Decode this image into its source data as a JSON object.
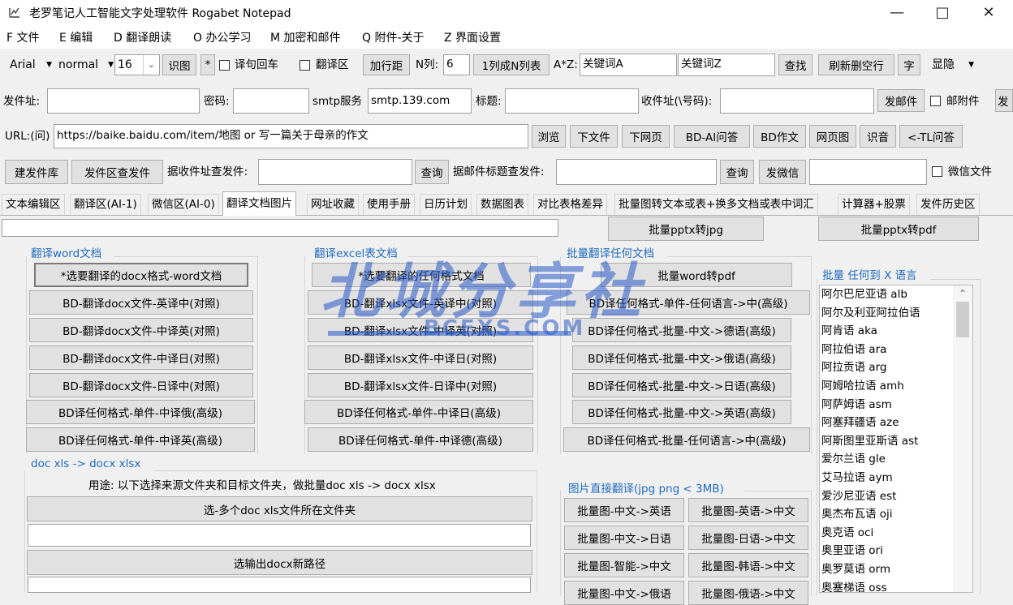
{
  "window": {
    "title": "老罗笔记人工智能文字处理软件 Rogabet Notepad"
  },
  "menu": [
    "F 文件",
    "E 编辑",
    "D 翻译朗读",
    "O 办公学习",
    "M 加密和邮件",
    "Q 附件-关于",
    "Z 界面设置"
  ],
  "toolbar1": {
    "font": "Arial",
    "style": "normal",
    "size": "16",
    "recognize": "识图",
    "star": "*",
    "wrap_label": "译句回车",
    "transarea_label": "翻译区",
    "add_spacing": "加行距",
    "ncol_label": "N列:",
    "ncol_value": "6",
    "one_to_n": "1列成N列表",
    "az_label": "A*Z:",
    "keyword_a": "关键词A",
    "keyword_z": "关键词Z",
    "find": "查找",
    "refresh_blank": "刷新删空行",
    "char": "字",
    "show_hide": "显隐"
  },
  "toolbar2": {
    "sender_label": "发件址:",
    "password_label": "密码:",
    "smtp_label": "smtp服务",
    "smtp_value": "smtp.139.com",
    "subject_label": "标题:",
    "recipient_label": "收件址(\\号码):",
    "send_mail": "发邮件",
    "attach_label": "邮附件",
    "extra": "发"
  },
  "toolbar3": {
    "url_label": "URL:(问)",
    "url_value": "https://baike.baidu.com/item/地图 or 写一篇关于母亲的作文",
    "browse": "浏览",
    "download_file": "下文件",
    "download_page": "下网页",
    "bd_ai": "BD-AI问答",
    "bd_essay": "BD作文",
    "webpage_image": "网页图",
    "recognize_sound": "识音",
    "tl_qa": "<-TL问答"
  },
  "toolbar4": {
    "build_library": "建发件库",
    "query_sent": "发件区查发件",
    "by_recipient_label": "据收件址查发件:",
    "query1": "查询",
    "by_subject_label": "据邮件标题查发件:",
    "query2": "查询",
    "send_wechat": "发微信",
    "wechat_file_label": "微信文件"
  },
  "tabs": [
    "文本编辑区",
    "翻译区(AI-1)",
    "微信区(AI-0)",
    "翻译文档图片",
    "网址收藏",
    "使用手册",
    "日历计划",
    "数据图表",
    "对比表格差异",
    "批量图转文本或表+换多文档或表中词汇",
    "计算器+股票",
    "发件历史区"
  ],
  "active_tab_index": 3,
  "top_buttons": {
    "pptx_jpg": "批量pptx转jpg",
    "pptx_pdf": "批量pptx转pdf"
  },
  "word_group": {
    "title": "翻译word文档",
    "buttons": [
      "*选要翻译的docx格式-word文档",
      "BD-翻译docx文件-英译中(对照)",
      "BD-翻译docx文件-中译英(对照)",
      "BD-翻译docx文件-中译日(对照)",
      "BD-翻译docx文件-日译中(对照)",
      "BD译任何格式-单件-中译俄(高级)",
      "BD译任何格式-单件-中译英(高级)"
    ]
  },
  "excel_group": {
    "title": "翻译excel表文档",
    "buttons": [
      "*选要翻译的任何格式文档",
      "BD-翻译xlsx文件-英译中(对照)",
      "BD-翻译xlsx文件-中译英(对照)",
      "BD-翻译xlsx文件-中译日(对照)",
      "BD-翻译xlsx文件-日译中(对照)",
      "BD译任何格式-单件-中译日(高级)",
      "BD译任何格式-单件-中译德(高级)"
    ]
  },
  "batch_group": {
    "title": "批量翻译任何文档",
    "buttons": [
      "批量word转pdf",
      "BD译任何格式-单件-任何语言->中(高级)",
      "BD译任何格式-批量-中文->德语(高级)",
      "BD译任何格式-批量-中文->俄语(高级)",
      "BD译任何格式-批量-中文->日语(高级)",
      "BD译任何格式-批量-中文->英语(高级)",
      "BD译任何格式-批量-任何语言->中(高级)"
    ]
  },
  "convert_group": {
    "title": "doc xls -> docx xlsx",
    "usage": "用途: 以下选择来源文件夹和目标文件夹，做批量doc xls -> docx xlsx",
    "select_source": "选-多个doc xls文件所在文件夹",
    "select_output": "选输出docx新路径"
  },
  "image_group": {
    "title": "图片直接翻译(jpg png < 3MB)",
    "buttons": [
      "批量图-中文->英语",
      "批量图-英语->中文",
      "批量图-中文->日语",
      "批量图-日语->中文",
      "批量图-智能->中文",
      "批量图-韩语->中文",
      "批量图-中文->俄语",
      "批量图-俄语->中文"
    ]
  },
  "language_group": {
    "title": "批量 任何到 X 语言",
    "items": [
      "阿尔巴尼亚语 alb",
      "阿尔及利亚阿拉伯语",
      "阿肯语 aka",
      "阿拉伯语 ara",
      "阿拉贡语 arg",
      "阿姆哈拉语 amh",
      "阿萨姆语 asm",
      "阿塞拜疆语 aze",
      "阿斯图里亚斯语 ast",
      "爱尔兰语 gle",
      "艾马拉语 aym",
      "爱沙尼亚语 est",
      "奥杰布瓦语 oji",
      "奥克语 oci",
      "奥里亚语 ori",
      "奥罗莫语 orm",
      "奥塞梯语 oss"
    ]
  },
  "watermark": {
    "main": "北城分享社",
    "sub": "BCFXS.COM"
  }
}
